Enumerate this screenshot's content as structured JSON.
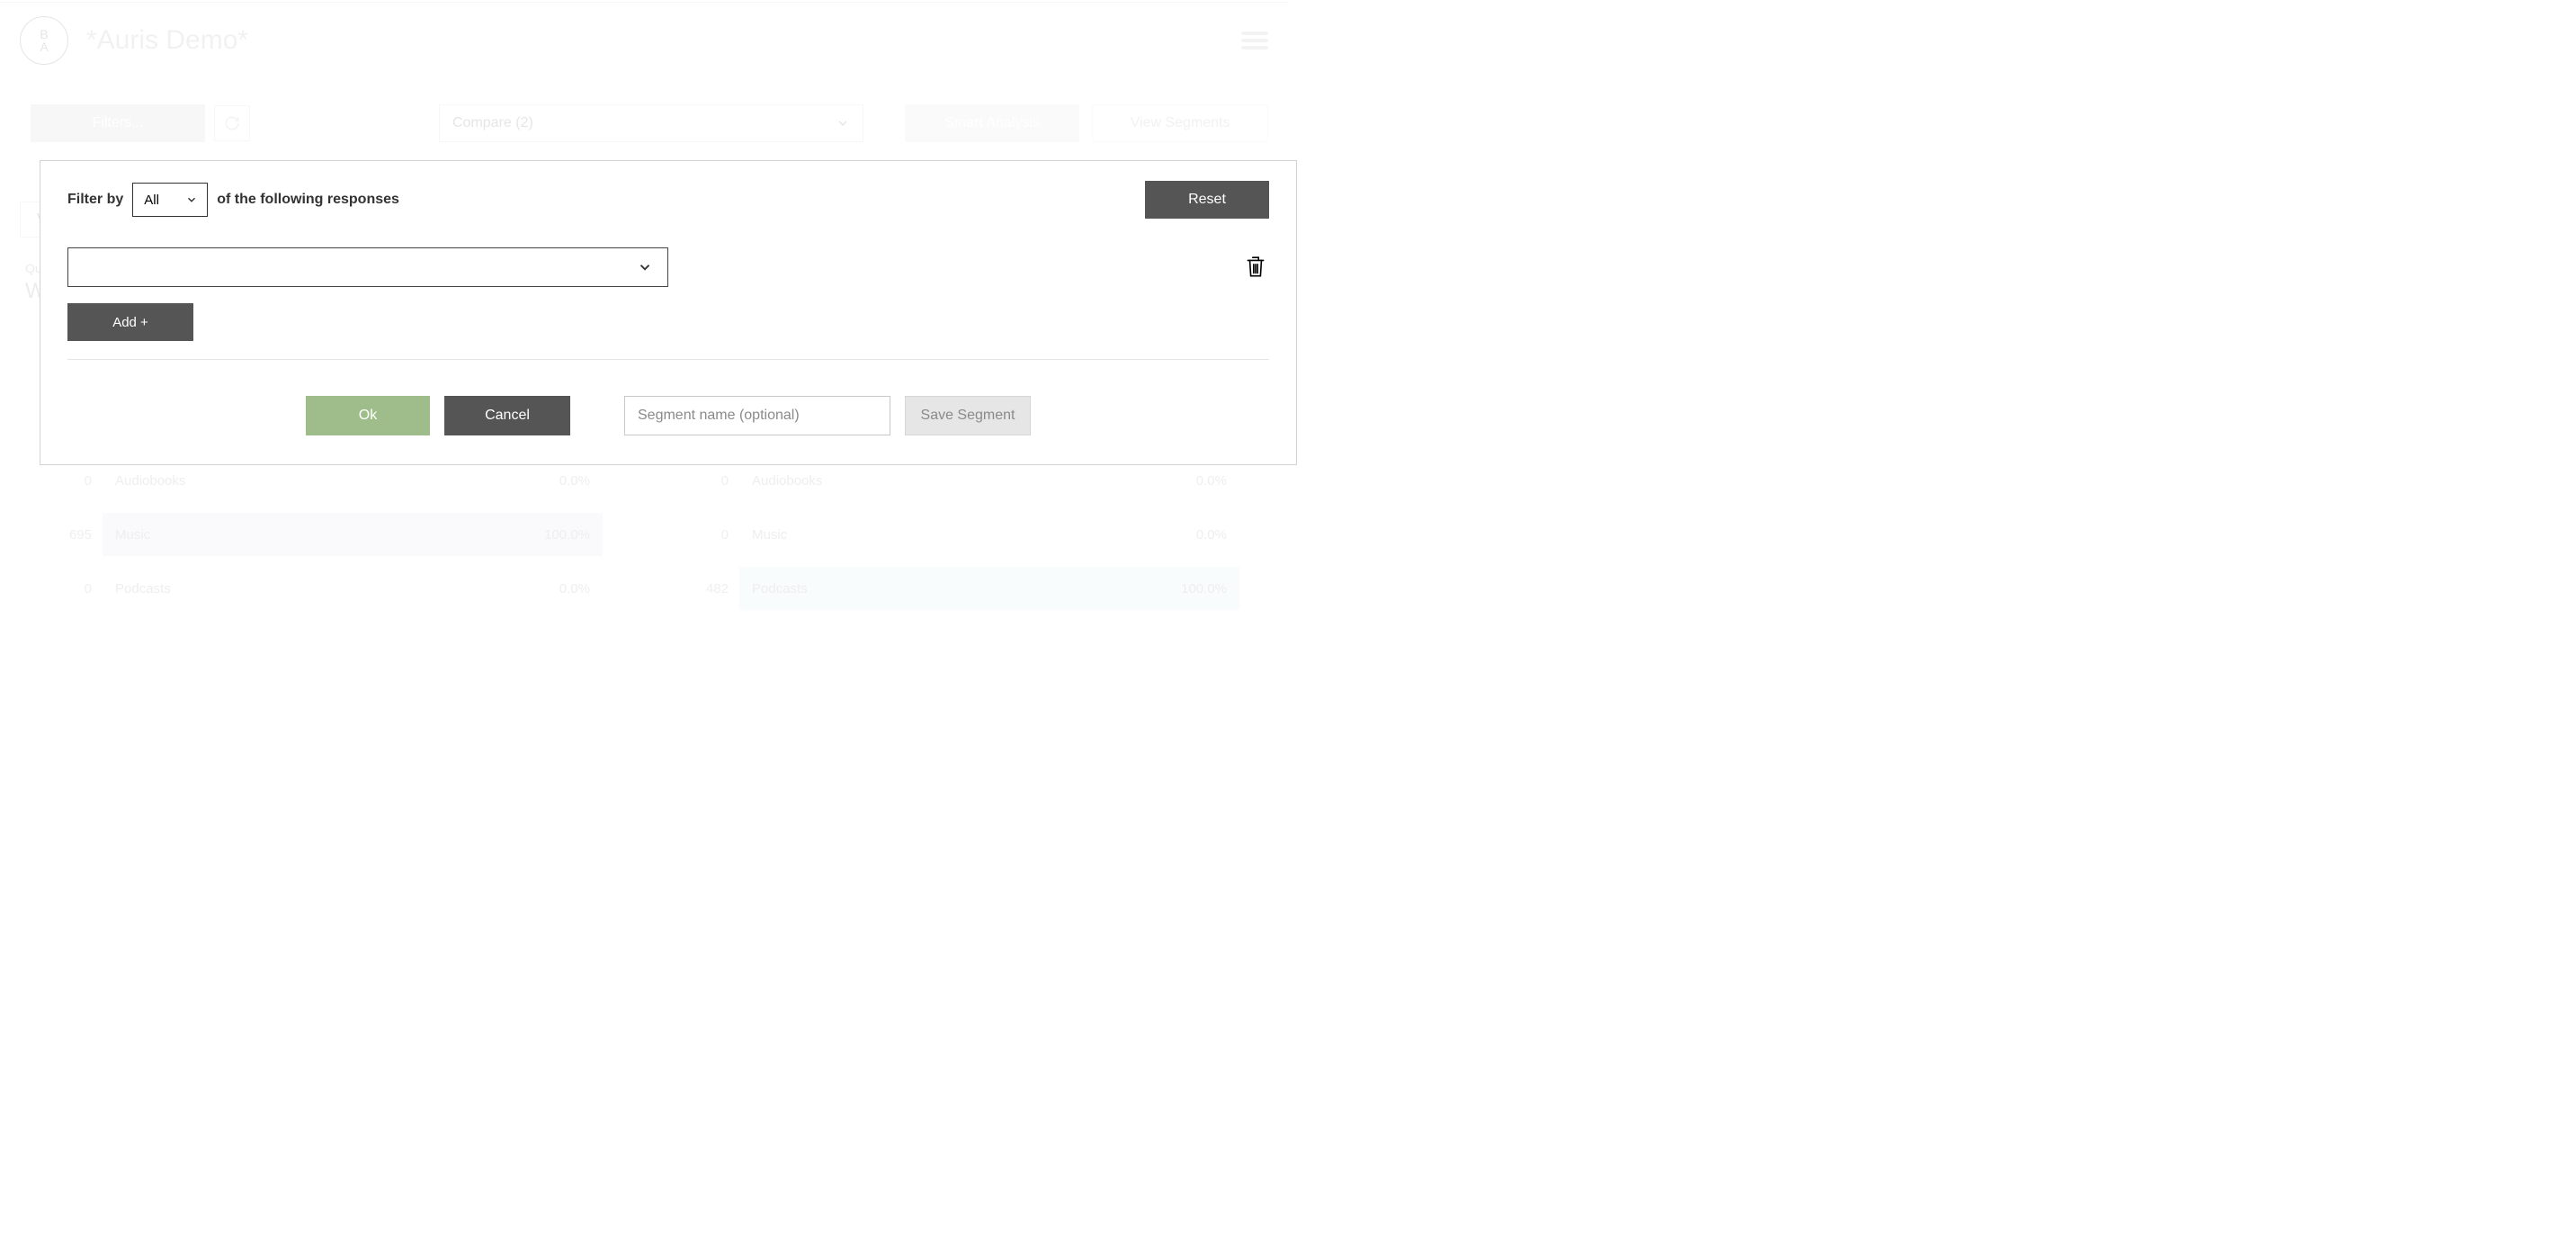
{
  "header": {
    "logo_letters": "B\nA",
    "title": "*Auris Demo*"
  },
  "toolbar": {
    "filters_label": "Filters...",
    "compare_label": "Compare (2)",
    "smart_label": "Smart Analysis",
    "view_segments_label": "View Segments"
  },
  "subnav": {
    "view_label": "View"
  },
  "question": {
    "label": "Ques",
    "text": "Wha"
  },
  "modal": {
    "filter_by_label": "Filter by",
    "all_label": "All",
    "followup_label": "of the following responses",
    "reset_label": "Reset",
    "add_label": "Add +",
    "ok_label": "Ok",
    "cancel_label": "Cancel",
    "segment_placeholder": "Segment name (optional)",
    "save_segment_label": "Save Segment"
  },
  "bars": {
    "left": [
      {
        "count": "0",
        "label": "Audiobooks",
        "pct": "0.0%",
        "filled": false
      },
      {
        "count": "695",
        "label": "Music",
        "pct": "100.0%",
        "filled": true
      },
      {
        "count": "0",
        "label": "Podcasts",
        "pct": "0.0%",
        "filled": false
      }
    ],
    "right": [
      {
        "count": "0",
        "label": "Audiobooks",
        "pct": "0.0%",
        "filled": false
      },
      {
        "count": "0",
        "label": "Music",
        "pct": "0.0%",
        "filled": false
      },
      {
        "count": "482",
        "label": "Podcasts",
        "pct": "100.0%",
        "filled": true
      }
    ]
  },
  "chart_data": [
    {
      "type": "bar",
      "title": "",
      "categories": [
        "Audiobooks",
        "Music",
        "Podcasts"
      ],
      "values": [
        0,
        695,
        0
      ],
      "percentages": [
        0.0,
        100.0,
        0.0
      ],
      "xlim": [
        0,
        100
      ]
    },
    {
      "type": "bar",
      "title": "",
      "categories": [
        "Audiobooks",
        "Music",
        "Podcasts"
      ],
      "values": [
        0,
        0,
        482
      ],
      "percentages": [
        0.0,
        0.0,
        100.0
      ],
      "xlim": [
        0,
        100
      ]
    }
  ]
}
